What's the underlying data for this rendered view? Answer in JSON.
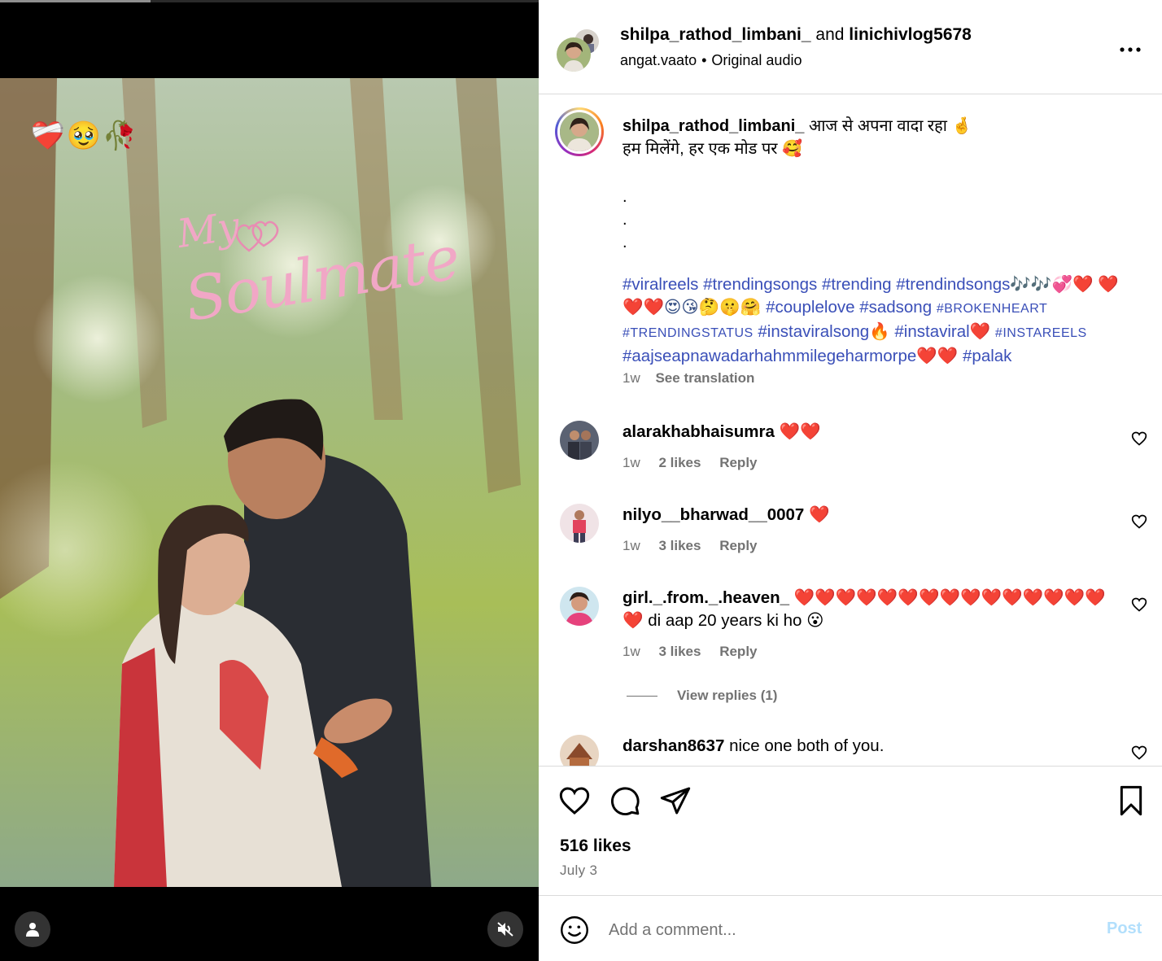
{
  "media": {
    "stickers": [
      "❤️‍🩹",
      "🥹",
      "🥀"
    ],
    "overlay_text_line1": "My",
    "overlay_text_line2": "Soulmate",
    "progress_fraction": 0.28,
    "user_tag_icon": "user-icon",
    "mute_icon": "speaker-muted-icon"
  },
  "header": {
    "user1": "shilpa_rathod_limbani_",
    "connector": "and",
    "user2": "linichivlog5678",
    "audio_user": "angat.vaato",
    "separator": "•",
    "audio_label": "Original audio",
    "more_icon": "more-horizontal-icon"
  },
  "caption": {
    "username": "shilpa_rathod_limbani_",
    "line1": "आज से अपना वादा रहा 🤞",
    "line2": "हम मिलेंगे, हर एक मोड पर 🥰",
    "dots": [
      ".",
      ".",
      "."
    ],
    "tags": [
      "#viralreels",
      "#trendingsongs",
      "#trending",
      "#trendindsongs🎶🎶💞❤️",
      "❤️❤️❤️😍😘🤔🤫🤗",
      "#couplelove",
      "#sadsong",
      "#BROKENHEART",
      "#TRENDINGSTATUS",
      "#instaviralsong🔥",
      "#instaviral❤️",
      "#INSTAREELS",
      "#aajseapnawadarhahmmilegeharmorpe❤️❤️",
      "#palak"
    ],
    "time": "1w",
    "see_translation": "See translation"
  },
  "comments": [
    {
      "username": "alarakhabhaisumra",
      "text": "❤️❤️",
      "time": "1w",
      "likes": "2 likes",
      "reply": "Reply"
    },
    {
      "username": "nilyo__bharwad__0007",
      "text": "❤️",
      "time": "1w",
      "likes": "3 likes",
      "reply": "Reply"
    },
    {
      "username": "girl._.from._.heaven_",
      "text": "❤️❤️❤️❤️❤️❤️❤️❤️❤️❤️❤️❤️❤️❤️❤️❤️ di aap 20 years ki ho 😮",
      "time": "1w",
      "likes": "3 likes",
      "reply": "Reply",
      "view_replies": "View replies (1)"
    },
    {
      "username": "darshan8637",
      "text": "nice one both of you."
    }
  ],
  "actions": {
    "like_icon": "heart-icon",
    "comment_icon": "comment-icon",
    "share_icon": "share-icon",
    "save_icon": "bookmark-icon",
    "likes": "516 likes",
    "date": "July 3"
  },
  "add_comment": {
    "emoji_icon": "emoji-icon",
    "placeholder": "Add a comment...",
    "post_label": "Post",
    "post_color": "#b2dffc"
  },
  "colors": {
    "hashtag": "#3a4fb8",
    "muted": "#737373",
    "divider": "#dbdbdb"
  }
}
